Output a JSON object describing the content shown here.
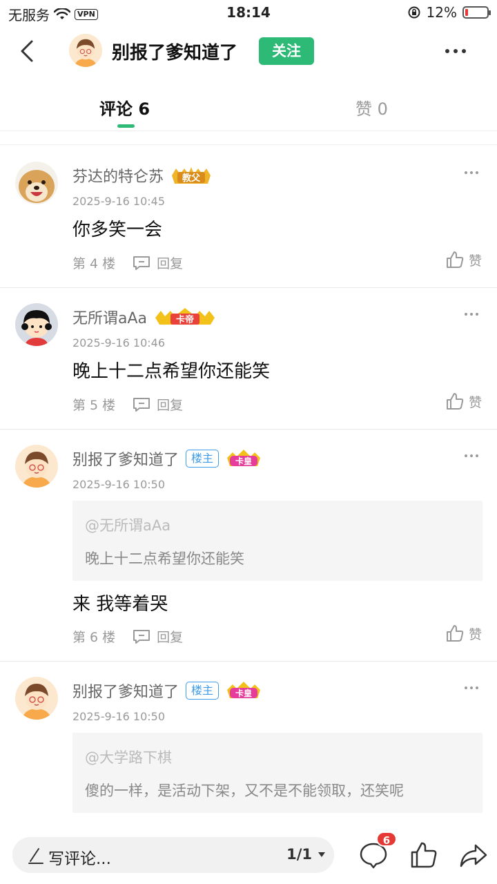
{
  "status_bar": {
    "carrier": "无服务",
    "vpn": "VPN",
    "time": "18:14",
    "battery": "12%"
  },
  "header": {
    "title": "别报了爹知道了",
    "follow_label": "关注"
  },
  "tabs": [
    {
      "label": "评论 6"
    },
    {
      "label": "赞 0"
    }
  ],
  "comments": [
    {
      "user": "芬达的特仑苏",
      "badge": "教父",
      "time": "2025-9-16 10:45",
      "text": "你多笑一会",
      "floor": "第 4 楼",
      "reply": "回复",
      "like": "赞"
    },
    {
      "user": "无所谓aAa",
      "badge": "卡帝",
      "time": "2025-9-16 10:46",
      "text": "晚上十二点希望你还能笑",
      "floor": "第 5 楼",
      "reply": "回复",
      "like": "赞"
    },
    {
      "user": "别报了爹知道了",
      "owner_badge": "楼主",
      "badge": "卡皇",
      "time": "2025-9-16 10:50",
      "quote_user": "@无所谓aAa",
      "quote_text": "晚上十二点希望你还能笑",
      "text": "来 我等着哭",
      "floor": "第 6 楼",
      "reply": "回复",
      "like": "赞"
    },
    {
      "user": "别报了爹知道了",
      "owner_badge": "楼主",
      "badge": "卡皇",
      "time": "2025-9-16 10:50",
      "quote_user": "@大学路下棋",
      "quote_text": "傻的一样，是活动下架，又不是不能领取，还笑呢"
    }
  ],
  "bottom_bar": {
    "write_placeholder": "写评论...",
    "page": "1/1",
    "comment_count": "6"
  },
  "colors": {
    "accent_green": "#2db976",
    "owner_blue": "#3d9be9",
    "badge_red": "#e53935"
  }
}
